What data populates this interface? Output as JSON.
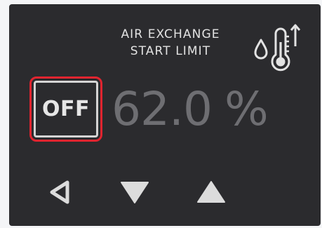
{
  "panel": {
    "title_line1": "AIR EXCHANGE",
    "title_line2": "START LIMIT"
  },
  "icons": {
    "sensor": "humidity-temperature-up-icon",
    "back": "triangle-left-outline-icon",
    "down": "triangle-down-icon",
    "up": "triangle-up-icon"
  },
  "toggle": {
    "label": "OFF",
    "state": "off"
  },
  "setpoint": {
    "value": "62.0",
    "unit": "%"
  },
  "colors": {
    "background": "#2b2b2e",
    "highlight": "#e0242f",
    "text": "#e2e2e2",
    "value_dimmed": "#6e6e72"
  }
}
